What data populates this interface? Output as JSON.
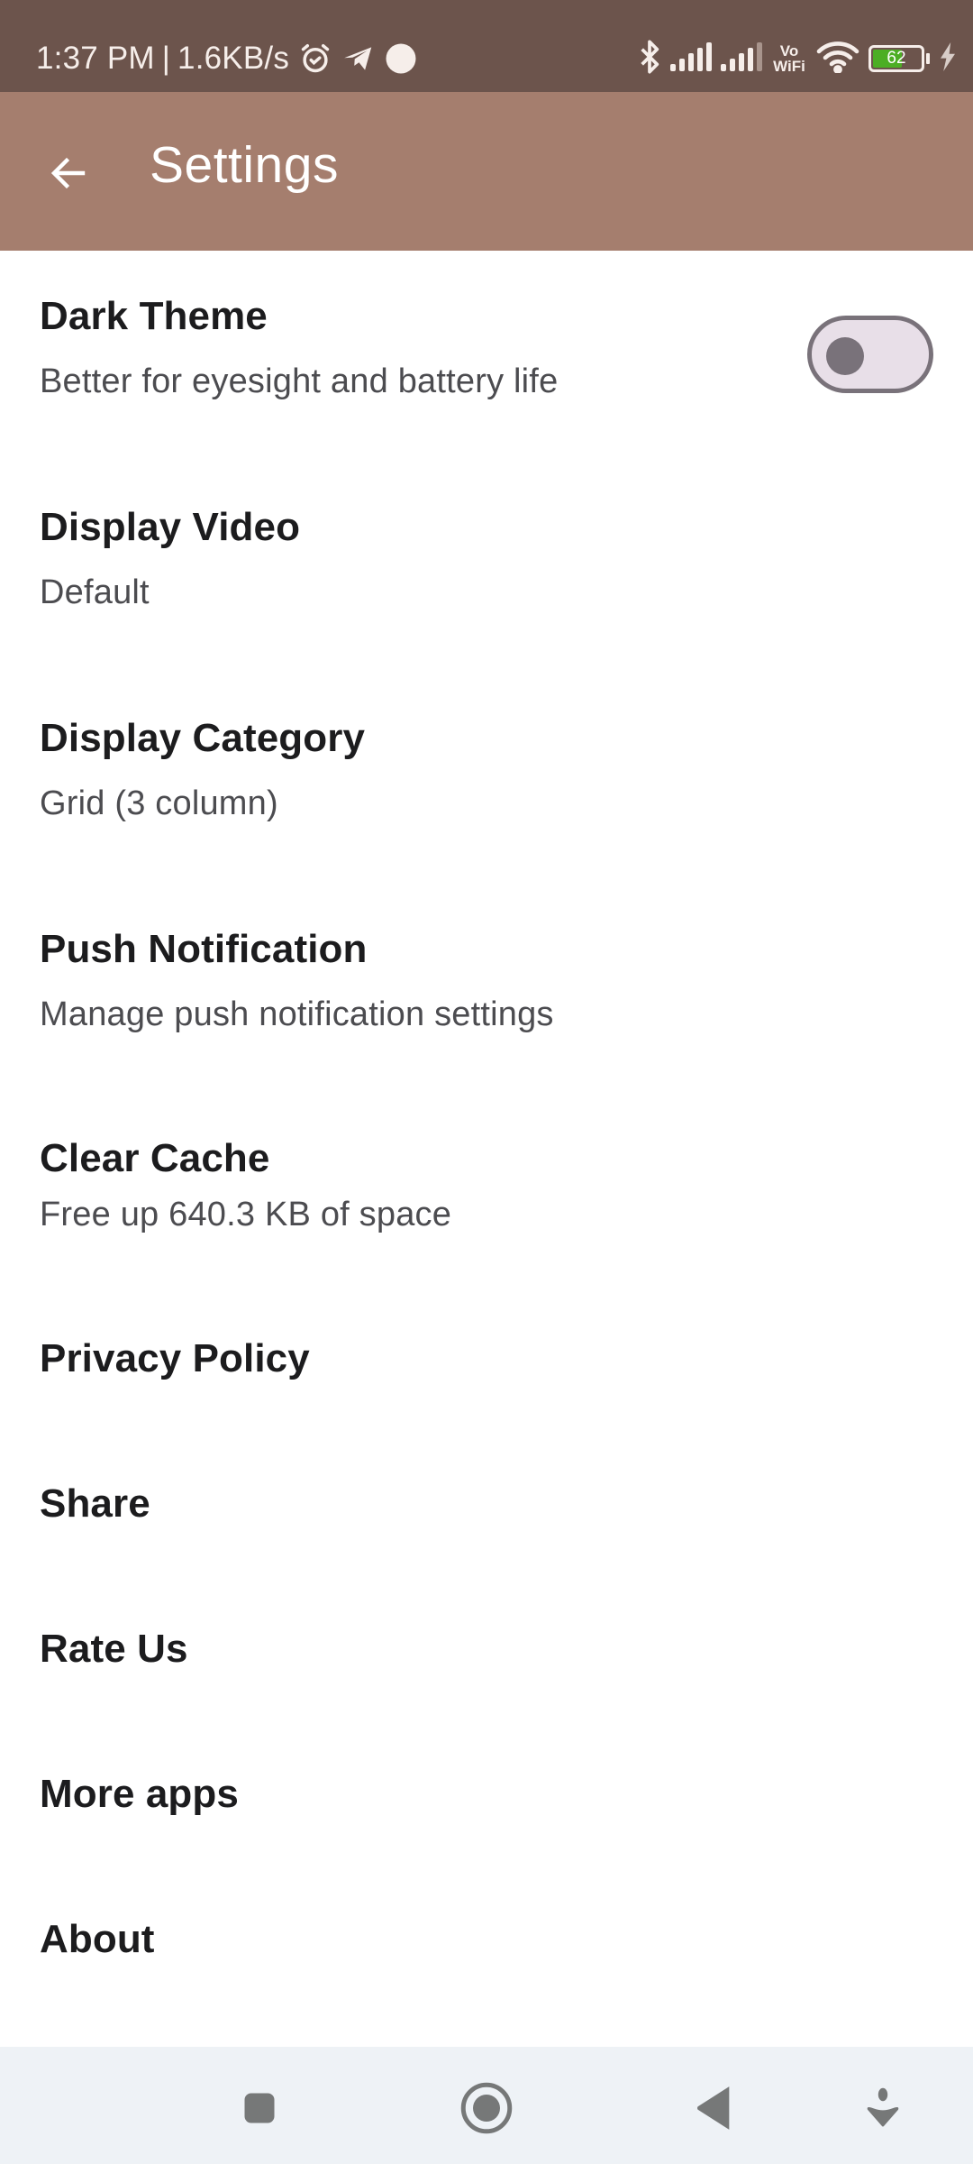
{
  "status_bar": {
    "time": "1:37 PM",
    "separator": "|",
    "network_speed": "1.6KB/s",
    "left_icons": [
      "alarm-icon",
      "telegram-icon",
      "notification-dot-icon"
    ],
    "right_icons": [
      "bluetooth-icon",
      "signal-sim1-icon",
      "signal-sim2-icon",
      "vowifi-icon",
      "wifi-icon",
      "battery-icon",
      "charging-icon"
    ],
    "vowifi_top": "Vo",
    "vowifi_bottom": "WiFi",
    "battery_level": "62",
    "battery_percent": 62,
    "battery_color": "#4cae24"
  },
  "app_bar": {
    "back_icon": "arrow-back-icon",
    "title": "Settings",
    "background_color": "#a57e6e"
  },
  "settings": [
    {
      "title": "Dark Theme",
      "subtitle": "Better for eyesight and battery life",
      "control": "toggle",
      "toggle_on": false
    },
    {
      "title": "Display Video",
      "subtitle": "Default"
    },
    {
      "title": "Display Category",
      "subtitle": "Grid (3 column)"
    },
    {
      "title": "Push Notification",
      "subtitle": "Manage push notification settings"
    },
    {
      "title": "Clear Cache",
      "subtitle": "Free up 640.3 KB of space"
    },
    {
      "title": "Privacy Policy"
    },
    {
      "title": "Share"
    },
    {
      "title": "Rate Us"
    },
    {
      "title": "More apps"
    },
    {
      "title": "About"
    }
  ],
  "nav_bar": {
    "buttons": [
      "recents-icon",
      "home-icon",
      "back-icon",
      "assist-icon"
    ]
  }
}
